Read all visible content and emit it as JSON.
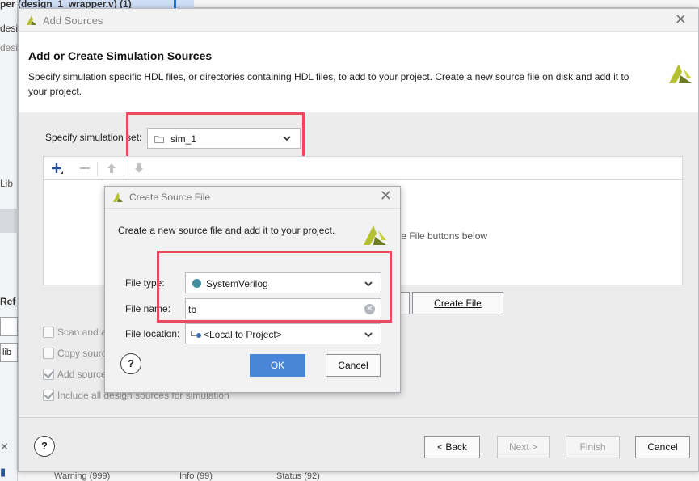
{
  "background": {
    "top_text": "per (design_1_wrapper.v) (1)",
    "left_texts": [
      "desi",
      "desi",
      "Lib",
      "Ref_",
      "lib"
    ],
    "bottom_texts": [
      "Warning (999)",
      "Info (99)",
      "Status (92)"
    ]
  },
  "main_dialog": {
    "title": "Add Sources",
    "heading": "Add or Create Simulation Sources",
    "description": "Specify simulation specific HDL files, or directories containing HDL files, to add to your project. Create a new source file on disk and add it to your project.",
    "sim_set_label": "Specify simulation set:",
    "sim_set_value": "sim_1",
    "hint_text": "te File buttons below",
    "create_file_label": "Create File",
    "options": [
      {
        "label": "Scan and a",
        "checked": false
      },
      {
        "label": "Copy sourc",
        "checked": false
      },
      {
        "label": "Add source",
        "checked": true
      },
      {
        "label": "Include all design sources for simulation",
        "checked": true
      }
    ],
    "nav": {
      "back": "< Back",
      "next": "Next >",
      "finish": "Finish",
      "cancel": "Cancel"
    },
    "help": "?"
  },
  "create_source_dialog": {
    "title": "Create Source File",
    "description": "Create a new source file and add it to your project.",
    "file_type_label": "File type:",
    "file_type_value": "SystemVerilog",
    "file_name_label": "File name:",
    "file_name_value": "tb",
    "file_location_label": "File location:",
    "file_location_value": "<Local to Project>",
    "ok": "OK",
    "cancel": "Cancel",
    "help": "?"
  },
  "colors": {
    "highlight": "#e84a5f",
    "ok_button": "#4a86d8",
    "logo": "#b5c12e",
    "systemverilog_dot": "#3f8ea0"
  }
}
